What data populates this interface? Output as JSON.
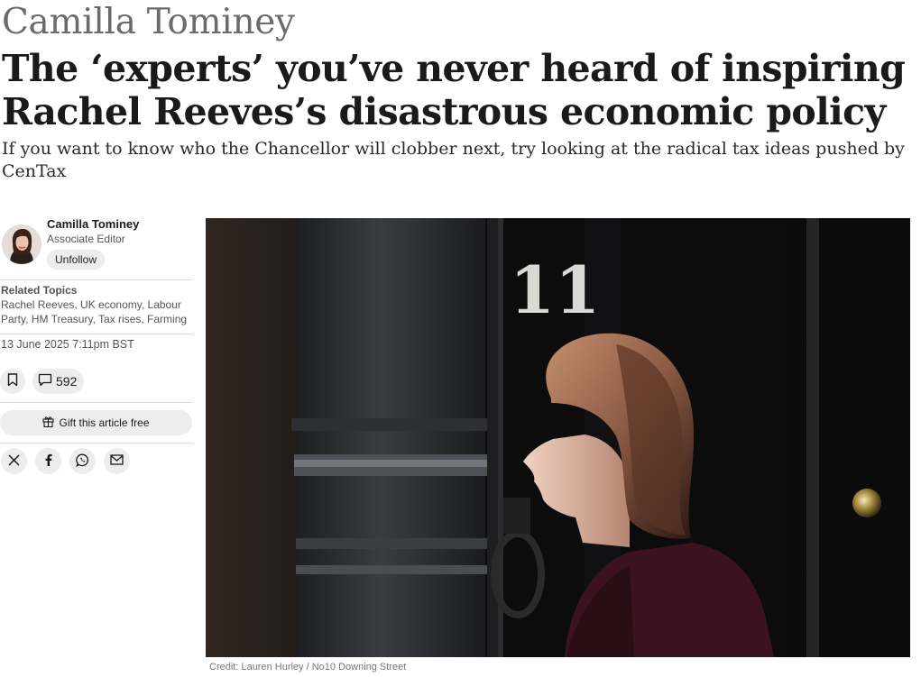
{
  "article": {
    "kicker": "Camilla Tominey",
    "headline": "The ‘experts’ you’ve never heard of inspiring Rachel Reeves’s disastrous economic policy",
    "standfirst": "If you want to know who the Chancellor will clobber next, try looking at the radical tax ideas pushed by CenTax"
  },
  "author": {
    "name": "Camilla Tominey",
    "role": "Associate Editor",
    "follow_label": "Unfollow"
  },
  "topics": {
    "heading": "Related Topics",
    "list": "Rachel Reeves, UK economy, Labour Party, HM Treasury, Tax rises, Farming"
  },
  "meta": {
    "date": "13 June 2025 7:11pm BST",
    "comment_count": "592"
  },
  "actions": {
    "gift_label": "Gift this article free",
    "icons": [
      "bookmark-icon",
      "comment-icon",
      "gift-icon",
      "x-icon",
      "facebook-icon",
      "whatsapp-icon",
      "email-icon"
    ]
  },
  "image": {
    "door_number": "11",
    "credit": "Credit: Lauren Hurley / No10 Downing Street"
  }
}
